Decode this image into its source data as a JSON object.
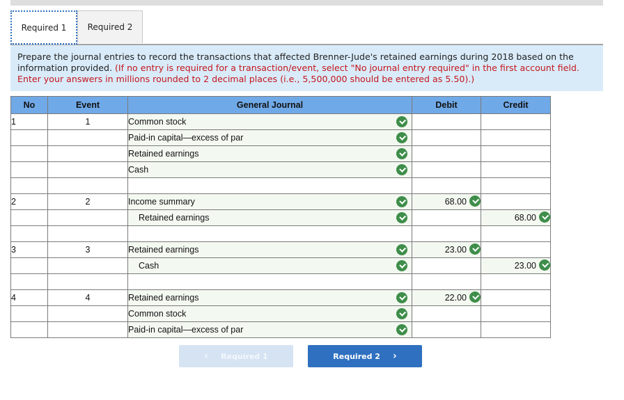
{
  "tabs": [
    {
      "label": "Required 1",
      "active": true
    },
    {
      "label": "Required 2",
      "active": false
    }
  ],
  "instructions": {
    "main": "Prepare the journal entries to record the transactions that affected Brenner-Jude's retained earnings during 2018 based on the information provided.",
    "note": "(If no entry is required for a transaction/event, select \"No journal entry required\" in the first account field. Enter your answers in millions rounded to 2 decimal places (i.e., 5,500,000 should be entered as 5.50).)"
  },
  "table": {
    "headers": {
      "no": "No",
      "event": "Event",
      "journal": "General Journal",
      "debit": "Debit",
      "credit": "Credit"
    },
    "rows": [
      {
        "no": "1",
        "event": "1",
        "account": "Common stock",
        "indent": false,
        "debit": "",
        "credit": "",
        "account_check": true
      },
      {
        "no": "",
        "event": "",
        "account": "Paid-in capital—excess of par",
        "indent": false,
        "debit": "",
        "credit": "",
        "account_check": true
      },
      {
        "no": "",
        "event": "",
        "account": "Retained earnings",
        "indent": false,
        "debit": "",
        "credit": "",
        "account_check": true
      },
      {
        "no": "",
        "event": "",
        "account": "Cash",
        "indent": false,
        "debit": "",
        "credit": "",
        "account_check": true
      },
      {
        "no": "",
        "event": "",
        "account": "",
        "indent": false,
        "debit": "",
        "credit": "",
        "account_check": false
      },
      {
        "no": "2",
        "event": "2",
        "account": "Income summary",
        "indent": false,
        "debit": "68.00",
        "credit": "",
        "account_check": true
      },
      {
        "no": "",
        "event": "",
        "account": "Retained earnings",
        "indent": true,
        "debit": "",
        "credit": "68.00",
        "account_check": true
      },
      {
        "no": "",
        "event": "",
        "account": "",
        "indent": false,
        "debit": "",
        "credit": "",
        "account_check": false
      },
      {
        "no": "3",
        "event": "3",
        "account": "Retained earnings",
        "indent": false,
        "debit": "23.00",
        "credit": "",
        "account_check": true
      },
      {
        "no": "",
        "event": "",
        "account": "Cash",
        "indent": true,
        "debit": "",
        "credit": "23.00",
        "account_check": true
      },
      {
        "no": "",
        "event": "",
        "account": "",
        "indent": false,
        "debit": "",
        "credit": "",
        "account_check": false
      },
      {
        "no": "4",
        "event": "4",
        "account": "Retained earnings",
        "indent": false,
        "debit": "22.00",
        "credit": "",
        "account_check": true
      },
      {
        "no": "",
        "event": "",
        "account": "Common stock",
        "indent": false,
        "debit": "",
        "credit": "",
        "account_check": true
      },
      {
        "no": "",
        "event": "",
        "account": "Paid-in capital—excess of par",
        "indent": false,
        "debit": "",
        "credit": "",
        "account_check": true
      }
    ]
  },
  "nav": {
    "prev_label": "Required 1",
    "next_label": "Required 2",
    "prev_icon": "chevron-left-icon",
    "next_icon": "chevron-right-icon"
  },
  "colors": {
    "header_blue": "#70a9e7",
    "instruction_bg": "#d9ebf9",
    "instruction_red": "#c4161c",
    "check_green": "#3e8e4a",
    "next_button": "#2f70c0",
    "prev_button_disabled": "#d5e3f3"
  }
}
